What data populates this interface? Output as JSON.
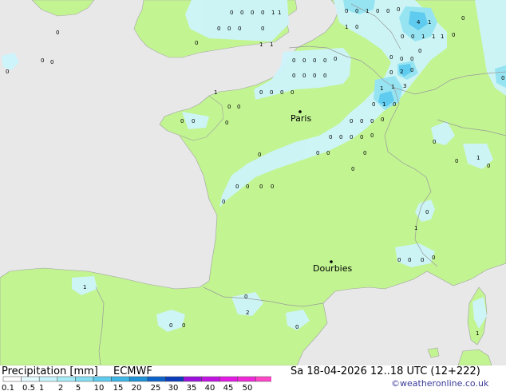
{
  "map": {
    "cities": [
      {
        "name": "Paris"
      },
      {
        "name": "Dourbies"
      }
    ],
    "cell_values": [
      "0",
      "1",
      "2",
      "3",
      "4"
    ]
  },
  "footer": {
    "title": "Precipitation [mm]",
    "model": "ECMWF",
    "datetime": "Sa 18-04-2026 12..18 UTC (12+222)",
    "credit": "©weatheronline.co.uk",
    "legend_ticks": [
      "0.1",
      "0.5",
      "1",
      "2",
      "5",
      "10",
      "15",
      "20",
      "25",
      "30",
      "35",
      "40",
      "45",
      "50"
    ],
    "legend_colors": [
      "#ffffff",
      "#e6fbff",
      "#c8f4fb",
      "#a6ecf6",
      "#84dff2",
      "#5fcbee",
      "#3eb6e6",
      "#1f92d8",
      "#0b62c9",
      "#0a3dbb",
      "#9b10dc",
      "#c214e0",
      "#e41ae4",
      "#f028d8",
      "#ff46c8"
    ]
  },
  "colors": {
    "sea": "#e8e8e8",
    "land": "#c2f492",
    "rain_light": "#cdf4fb",
    "rain_mid": "#96e4f2",
    "rain_heavy": "#5fcbee",
    "border": "#a0a0a0"
  }
}
